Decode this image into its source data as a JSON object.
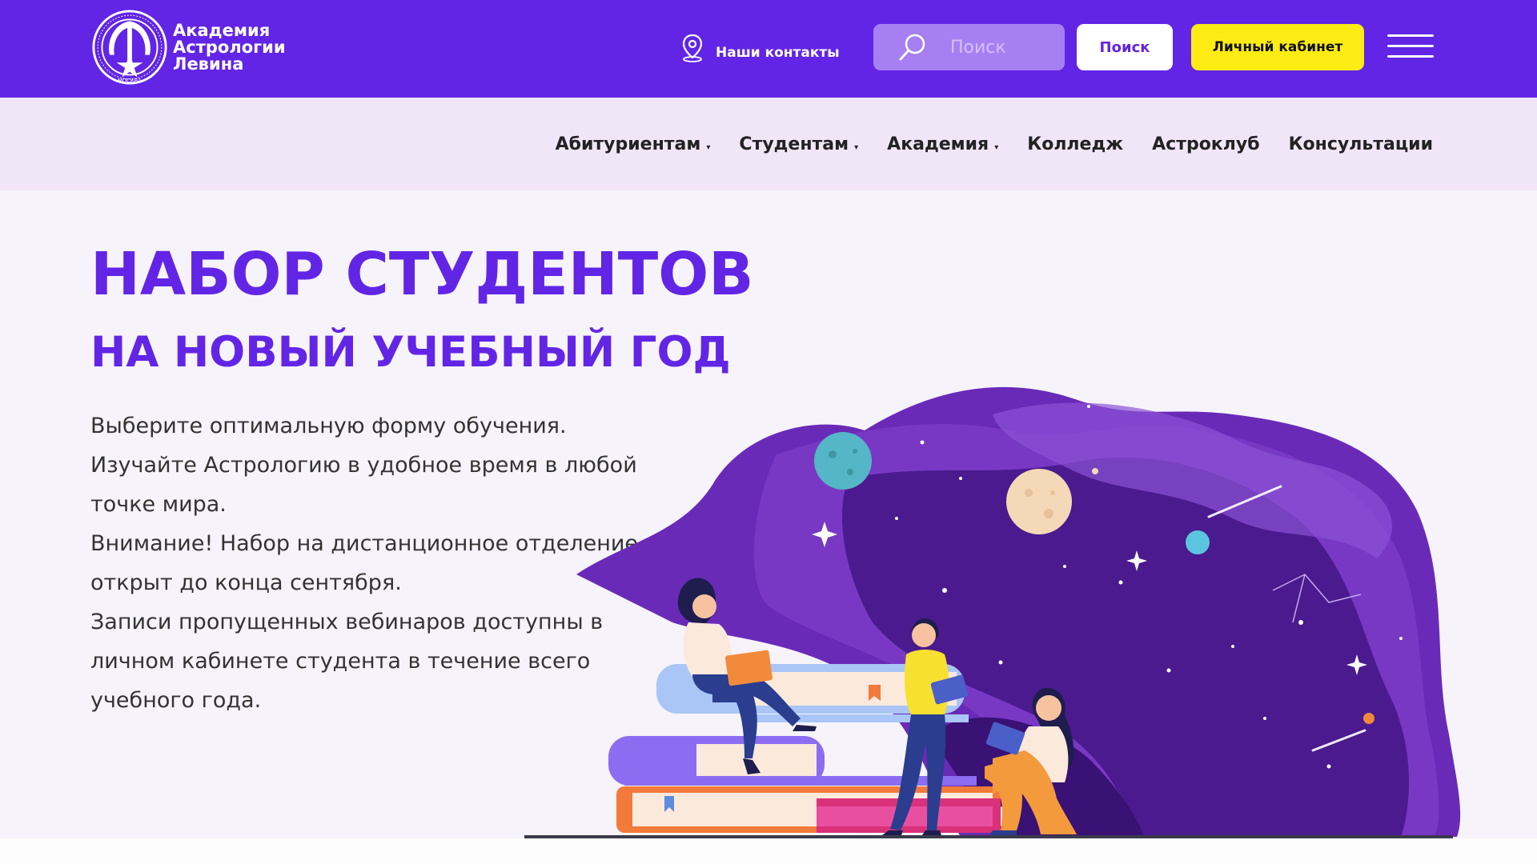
{
  "header": {
    "logo_lines": [
      "Академия",
      "Астрологии",
      "Левина"
    ],
    "logo_seal_text": "МОСКВА",
    "contacts_label": "Наши контакты",
    "search": {
      "placeholder": "Поиск",
      "button_label": "Поиск"
    },
    "account_label": "Личный кабинет"
  },
  "nav": {
    "items": [
      {
        "label": "Абитуриентам",
        "dropdown": true
      },
      {
        "label": "Студентам",
        "dropdown": true
      },
      {
        "label": "Академия",
        "dropdown": true
      },
      {
        "label": "Колледж",
        "dropdown": false
      },
      {
        "label": "Астроклуб",
        "dropdown": false
      },
      {
        "label": "Консультации",
        "dropdown": false
      }
    ],
    "caret_glyph": "▾"
  },
  "hero": {
    "title": "НАБОР СТУДЕНТОВ",
    "subtitle": "НА НОВЫЙ УЧЕБНЫЙ ГОД",
    "paragraphs": [
      "Выберите оптимальную форму обучения.",
      "Изучайте Астрологию в удобное время в любой точке мира.",
      "Внимание! Набор на дистанционное отделение открыт до конца сентября.",
      "Записи пропущенных вебинаров доступны в личном кабинете студента в течение всего учебного года."
    ]
  },
  "icons": {
    "contacts": "location-pin-icon",
    "search": "magnifier-icon",
    "menu": "hamburger-menu-icon"
  },
  "colors": {
    "brand_purple": "#6225e6",
    "nav_background": "#f1e6f8",
    "hero_background": "#f6f3fa",
    "account_yellow": "#fcec14",
    "search_field": "#a680f3"
  }
}
